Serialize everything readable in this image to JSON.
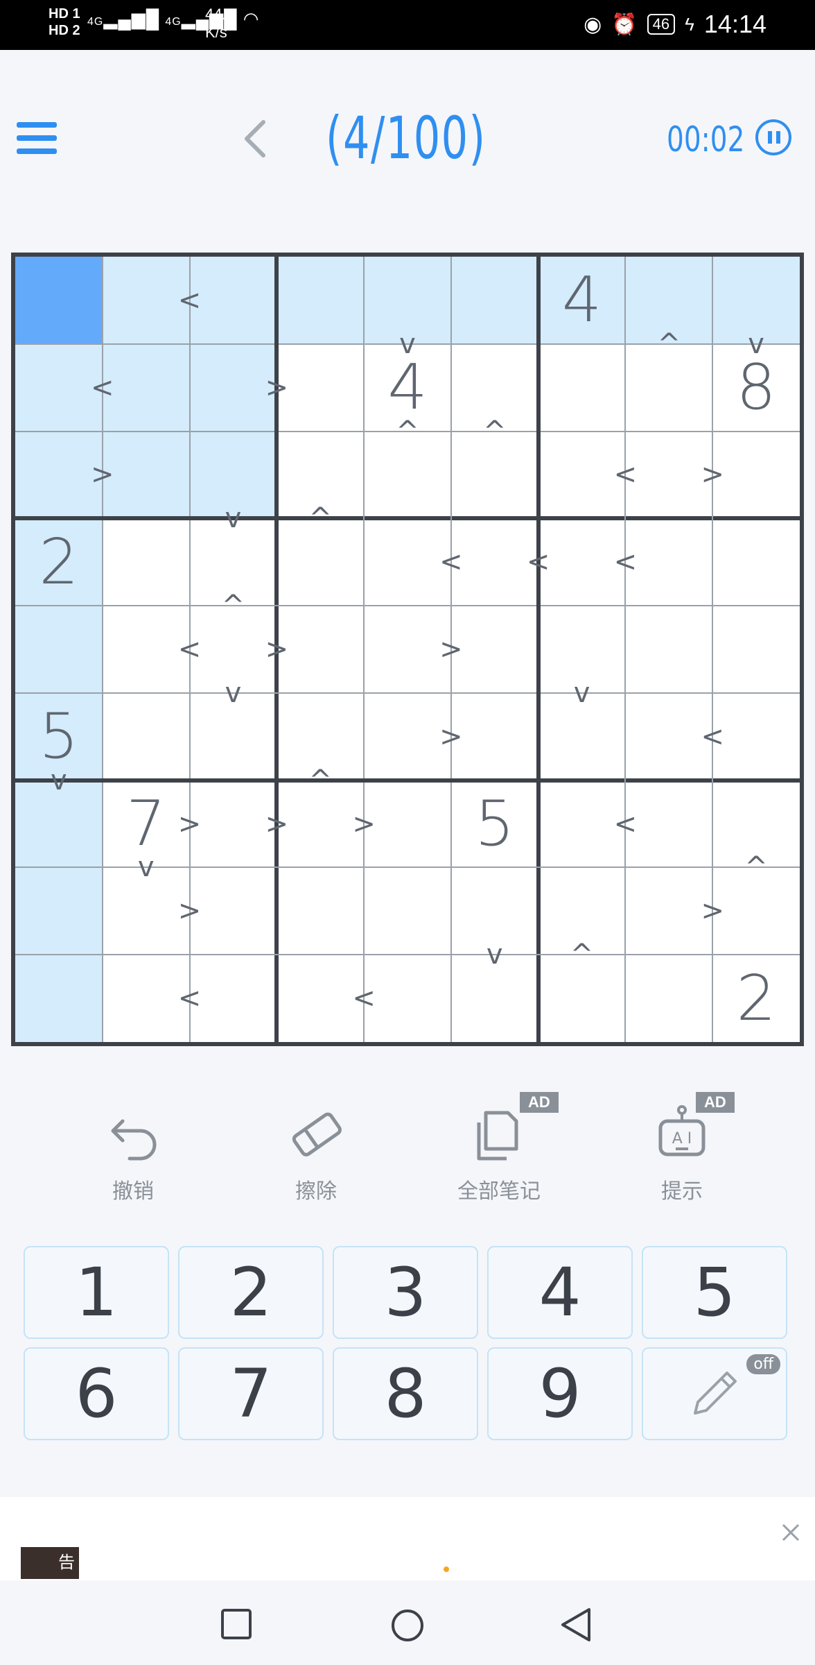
{
  "status_bar": {
    "hd1": "HD 1",
    "hd2": "HD 2",
    "network": "4G",
    "speed_value": "44.3",
    "speed_unit": "K/s",
    "battery": "46",
    "time": "14:14"
  },
  "header": {
    "level": "(4/100)",
    "timer": "00:02"
  },
  "board": {
    "digits": [
      [
        null,
        null,
        null,
        null,
        null,
        null,
        "4",
        null,
        null
      ],
      [
        null,
        null,
        null,
        null,
        "4",
        null,
        null,
        null,
        "8"
      ],
      [
        null,
        null,
        null,
        null,
        null,
        null,
        null,
        null,
        null
      ],
      [
        "2",
        null,
        null,
        null,
        null,
        null,
        null,
        null,
        null
      ],
      [
        null,
        null,
        null,
        null,
        null,
        null,
        null,
        null,
        null
      ],
      [
        "5",
        null,
        null,
        null,
        null,
        null,
        null,
        null,
        null
      ],
      [
        null,
        "7",
        null,
        null,
        null,
        "5",
        null,
        null,
        null
      ],
      [
        null,
        null,
        null,
        null,
        null,
        null,
        null,
        null,
        null
      ],
      [
        null,
        null,
        null,
        null,
        null,
        null,
        null,
        null,
        "2"
      ]
    ],
    "selected_cell": [
      0,
      0
    ],
    "highlighted_cells": [
      [
        0,
        1
      ],
      [
        0,
        2
      ],
      [
        0,
        3
      ],
      [
        0,
        4
      ],
      [
        0,
        5
      ],
      [
        0,
        6
      ],
      [
        0,
        7
      ],
      [
        0,
        8
      ],
      [
        1,
        0
      ],
      [
        1,
        1
      ],
      [
        1,
        2
      ],
      [
        2,
        0
      ],
      [
        2,
        1
      ],
      [
        2,
        2
      ],
      [
        3,
        0
      ],
      [
        4,
        0
      ],
      [
        5,
        0
      ],
      [
        6,
        0
      ],
      [
        7,
        0
      ],
      [
        8,
        0
      ]
    ],
    "h_ineq": [
      {
        "r": 0,
        "c": 1,
        "s": "<"
      },
      {
        "r": 1,
        "c": 0,
        "s": "<"
      },
      {
        "r": 1,
        "c": 2,
        "s": ">"
      },
      {
        "r": 2,
        "c": 0,
        "s": ">"
      },
      {
        "r": 2,
        "c": 6,
        "s": "<"
      },
      {
        "r": 2,
        "c": 7,
        "s": ">"
      },
      {
        "r": 3,
        "c": 4,
        "s": "<"
      },
      {
        "r": 3,
        "c": 5,
        "s": "<"
      },
      {
        "r": 3,
        "c": 6,
        "s": "<"
      },
      {
        "r": 4,
        "c": 1,
        "s": "<"
      },
      {
        "r": 4,
        "c": 2,
        "s": ">"
      },
      {
        "r": 4,
        "c": 4,
        "s": ">"
      },
      {
        "r": 5,
        "c": 4,
        "s": ">"
      },
      {
        "r": 5,
        "c": 7,
        "s": "<"
      },
      {
        "r": 6,
        "c": 1,
        "s": ">"
      },
      {
        "r": 6,
        "c": 2,
        "s": ">"
      },
      {
        "r": 6,
        "c": 3,
        "s": ">"
      },
      {
        "r": 6,
        "c": 6,
        "s": "<"
      },
      {
        "r": 7,
        "c": 1,
        "s": ">"
      },
      {
        "r": 7,
        "c": 7,
        "s": ">"
      },
      {
        "r": 8,
        "c": 1,
        "s": "<"
      },
      {
        "r": 8,
        "c": 3,
        "s": "<"
      }
    ],
    "v_ineq": [
      {
        "r": 0,
        "c": 4,
        "s": "v"
      },
      {
        "r": 0,
        "c": 7,
        "s": "^"
      },
      {
        "r": 0,
        "c": 8,
        "s": "v"
      },
      {
        "r": 1,
        "c": 4,
        "s": "^"
      },
      {
        "r": 1,
        "c": 5,
        "s": "^"
      },
      {
        "r": 2,
        "c": 2,
        "s": "v"
      },
      {
        "r": 2,
        "c": 3,
        "s": "^"
      },
      {
        "r": 3,
        "c": 2,
        "s": "^"
      },
      {
        "r": 4,
        "c": 2,
        "s": "v"
      },
      {
        "r": 4,
        "c": 6,
        "s": "v"
      },
      {
        "r": 5,
        "c": 0,
        "s": "v"
      },
      {
        "r": 5,
        "c": 3,
        "s": "^"
      },
      {
        "r": 6,
        "c": 1,
        "s": "v"
      },
      {
        "r": 6,
        "c": 8,
        "s": "^"
      },
      {
        "r": 7,
        "c": 5,
        "s": "v"
      },
      {
        "r": 7,
        "c": 6,
        "s": "^"
      }
    ]
  },
  "tools": {
    "undo": "撤销",
    "erase": "擦除",
    "notes_all": "全部笔记",
    "hint": "提示",
    "ad_badge": "AD"
  },
  "keypad": {
    "keys": [
      "1",
      "2",
      "3",
      "4",
      "5",
      "6",
      "7",
      "8",
      "9"
    ],
    "pencil_state": "off"
  },
  "ad_bar": {
    "label": "告"
  },
  "colors": {
    "accent": "#2f8ff0",
    "selected": "#64aafb",
    "highlight": "#d4ecfb",
    "grid": "#3d4249"
  }
}
